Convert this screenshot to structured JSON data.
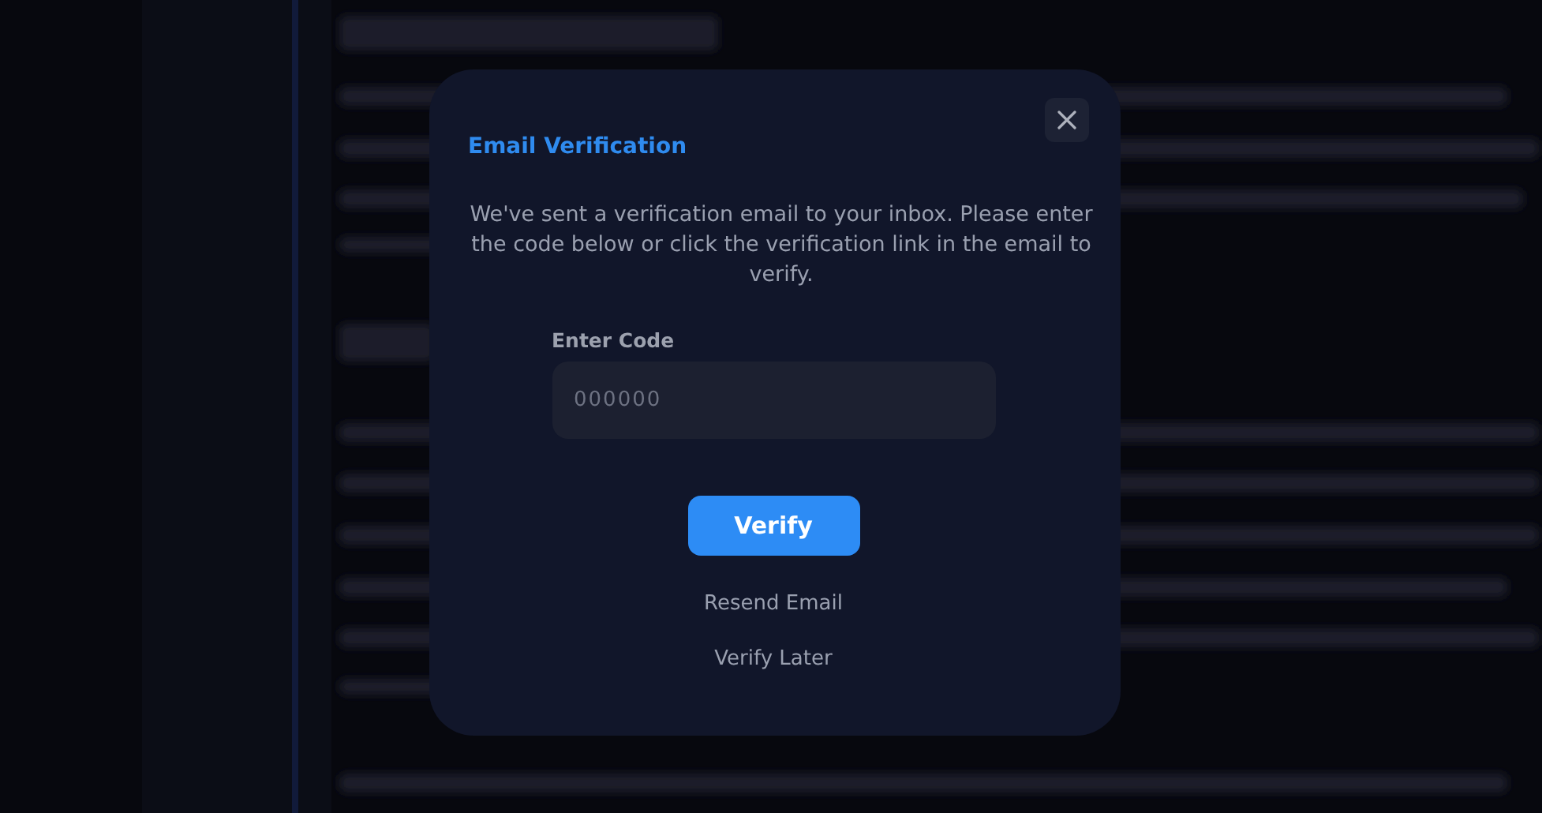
{
  "dialog": {
    "title": "Email Verification",
    "message": "We've sent a verification email to your inbox. Please enter the code below or click the verification link in the email to verify.",
    "code_field": {
      "label": "Enter Code",
      "placeholder": "000000"
    },
    "primary_button": "Verify",
    "links": [
      "Resend Email",
      "Verify Later"
    ]
  }
}
